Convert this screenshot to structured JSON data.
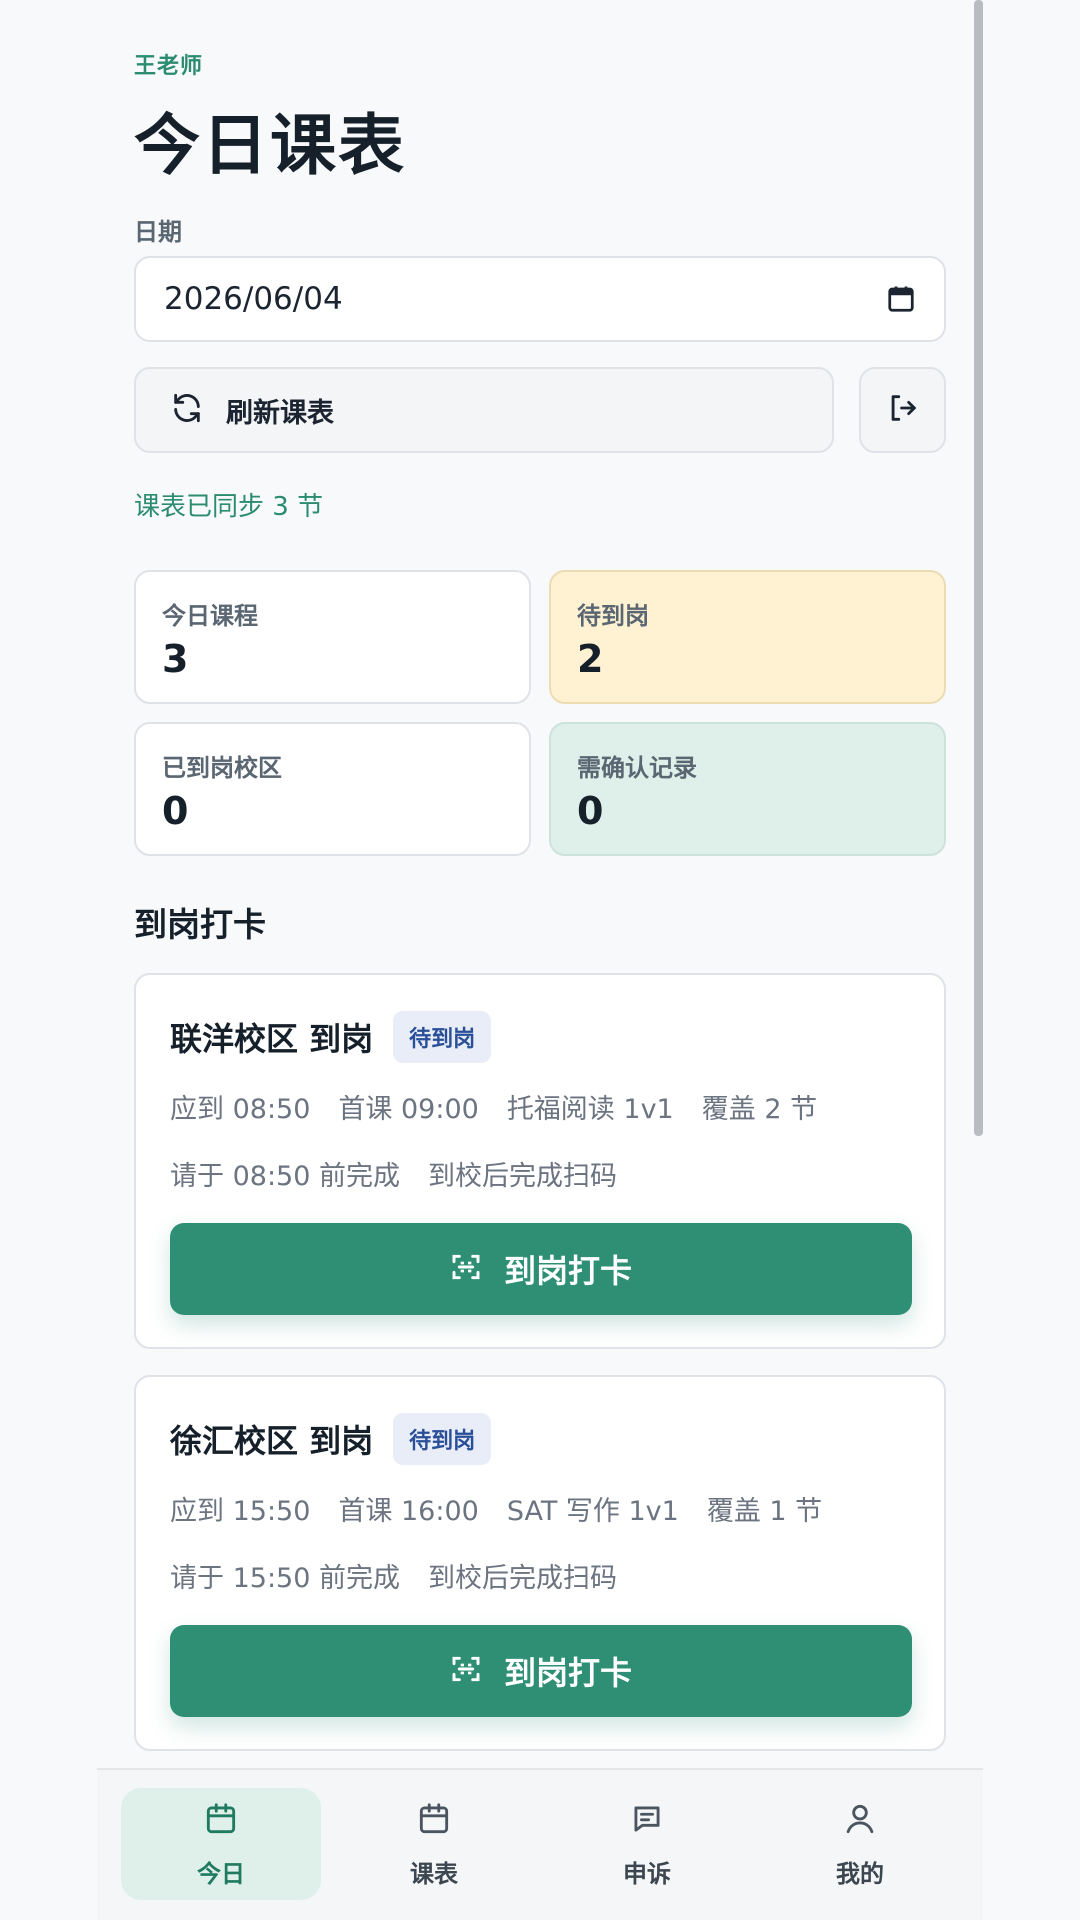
{
  "header": {
    "teacher": "王老师",
    "title": "今日课表"
  },
  "date": {
    "label": "日期",
    "value": "2026/06/04"
  },
  "actions": {
    "refresh_label": "刷新课表"
  },
  "sync_status": "课表已同步 3 节",
  "stats": [
    {
      "label": "今日课程",
      "value": "3"
    },
    {
      "label": "待到岗",
      "value": "2"
    },
    {
      "label": "已到岗校区",
      "value": "0"
    },
    {
      "label": "需确认记录",
      "value": "0"
    }
  ],
  "section_title": "到岗打卡",
  "cards": [
    {
      "title": "联洋校区 到岗",
      "badge": "待到岗",
      "meta1": [
        "应到 08:50",
        "首课 09:00",
        "托福阅读 1v1",
        "覆盖 2 节"
      ],
      "meta2": [
        "请于 08:50 前完成",
        "到校后完成扫码"
      ],
      "button": "到岗打卡"
    },
    {
      "title": "徐汇校区 到岗",
      "badge": "待到岗",
      "meta1": [
        "应到 15:50",
        "首课 16:00",
        "SAT 写作 1v1",
        "覆盖 1 节"
      ],
      "meta2": [
        "请于 15:50 前完成",
        "到校后完成扫码"
      ],
      "button": "到岗打卡"
    }
  ],
  "nav": [
    {
      "label": "今日",
      "icon": "calendar-icon",
      "active": true
    },
    {
      "label": "课表",
      "icon": "calendar-icon",
      "active": false
    },
    {
      "label": "申诉",
      "icon": "message-icon",
      "active": false
    },
    {
      "label": "我的",
      "icon": "user-icon",
      "active": false
    }
  ],
  "colors": {
    "accent": "#2e8f75",
    "warn_bg": "#fff2d3",
    "ok_bg": "#dff0ea",
    "badge_bg": "#e8edf7",
    "badge_text": "#2a4f99"
  }
}
